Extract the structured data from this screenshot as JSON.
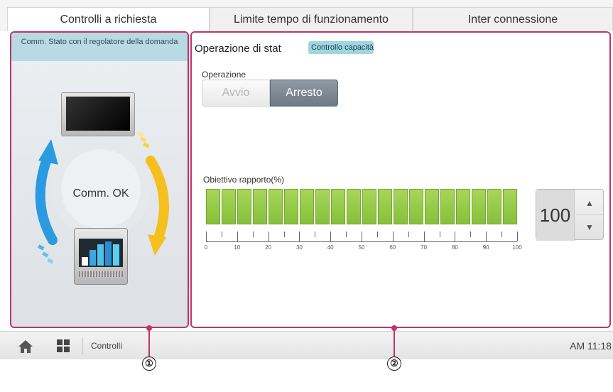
{
  "tabs": [
    {
      "label": "Controlli a richiesta",
      "active": true
    },
    {
      "label": "Limite tempo di funzionamento",
      "active": false
    },
    {
      "label": "Inter connessione",
      "active": false
    }
  ],
  "left_panel": {
    "header": "Comm. Stato con il regolatore della domanda",
    "status": "Comm. OK"
  },
  "right_panel": {
    "title": "Operazione di stat",
    "badge": "Controllo capacità",
    "operation_label": "Operazione",
    "start_label": "Avvio",
    "stop_label": "Arresto",
    "ratio_label": "Obiettivo rapporto(%)",
    "scale_labels": [
      "0",
      "10",
      "20",
      "30",
      "40",
      "50",
      "60",
      "70",
      "80",
      "90",
      "100"
    ],
    "value": "100",
    "gauge_percent": 100
  },
  "bottom": {
    "breadcrumb": "Controlli",
    "time": "AM 11:18"
  },
  "callouts": [
    "①",
    "②"
  ],
  "colors": {
    "accent": "#c0336b",
    "gauge": "#9ccf4f",
    "badge": "#9fd6e0"
  }
}
